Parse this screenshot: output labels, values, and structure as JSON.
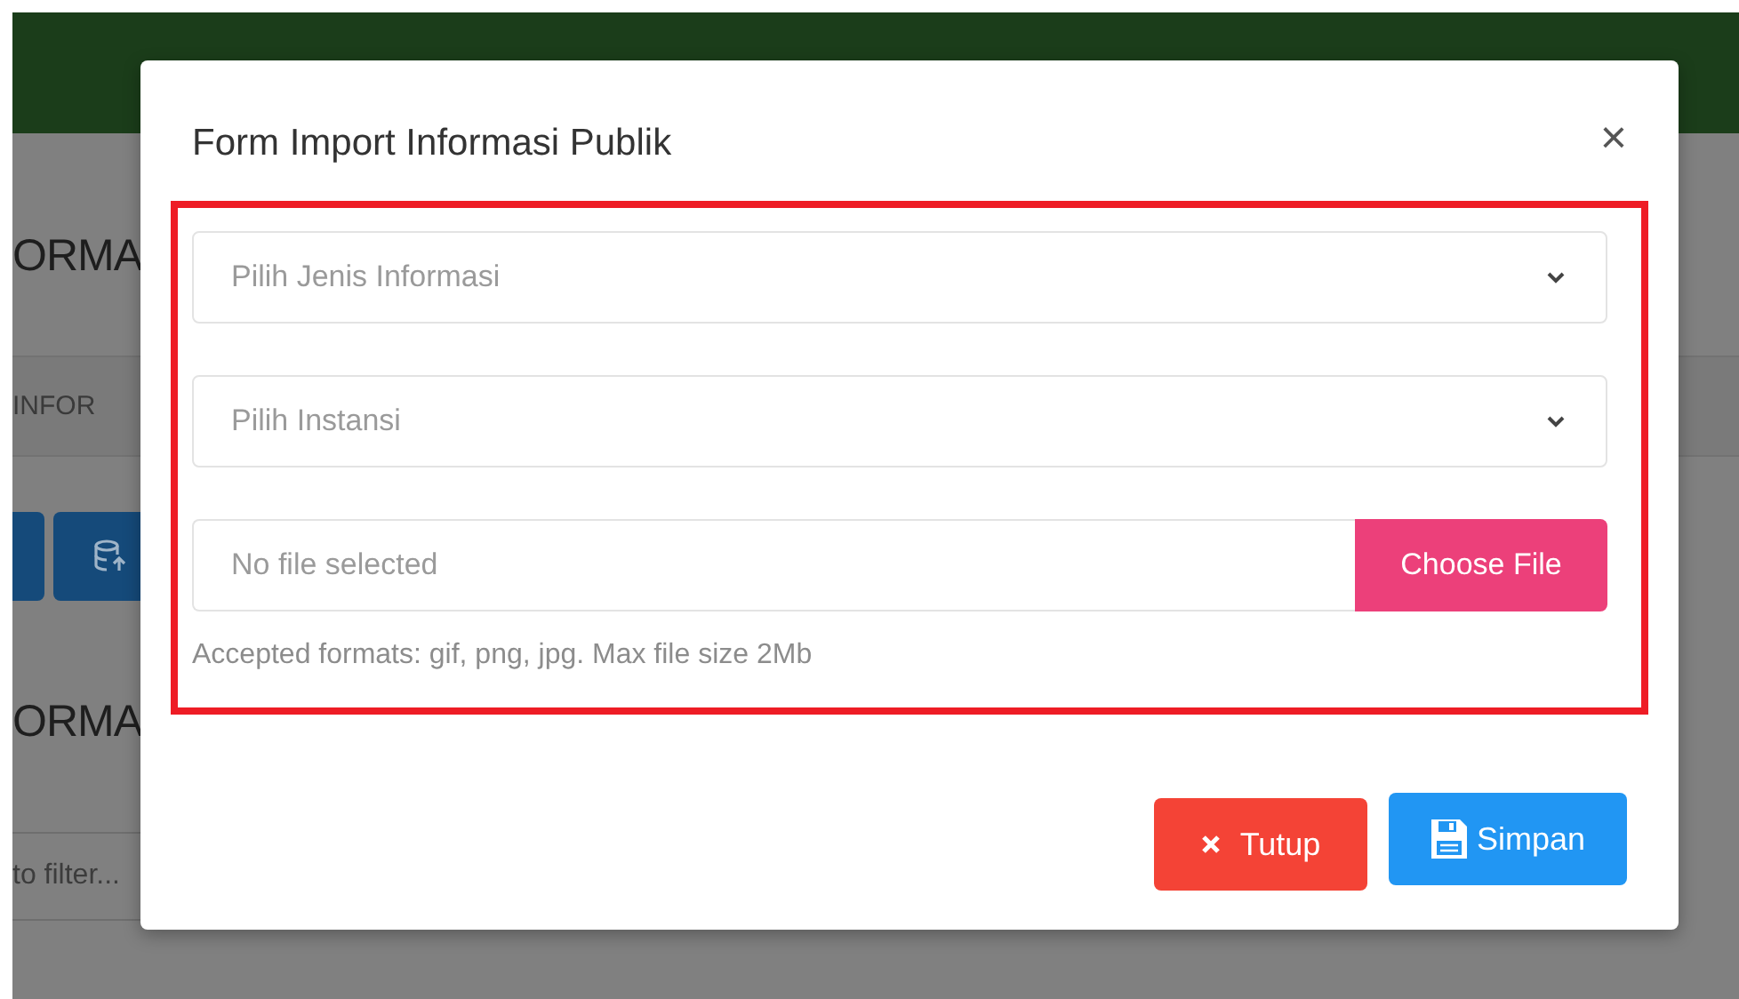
{
  "background": {
    "page_title": "ORMA",
    "breadcrumb": "INFOR",
    "section_title": "ORMA",
    "filter": {
      "placeholder": "to filter..."
    }
  },
  "modal": {
    "title": "Form Import Informasi Publik",
    "close": "×",
    "selects": [
      {
        "placeholder": "Pilih Jenis Informasi"
      },
      {
        "placeholder": "Pilih Instansi"
      }
    ],
    "file": {
      "status": "No file selected",
      "button": "Choose File",
      "hint": "Accepted formats: gif, png, jpg. Max file size 2Mb"
    },
    "buttons": [
      {
        "label": "Tutup",
        "kind": "close"
      },
      {
        "label": "Simpan",
        "kind": "save"
      }
    ]
  }
}
